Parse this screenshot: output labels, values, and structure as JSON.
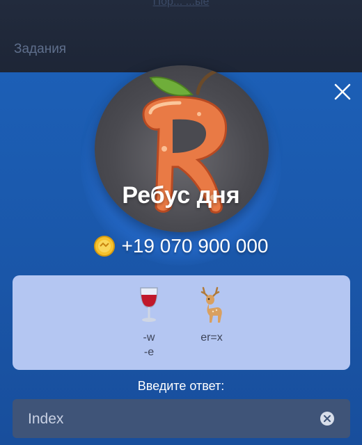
{
  "background": {
    "top_link": "Пор... ...ые",
    "tab_label": "Задания"
  },
  "modal": {
    "avatar_icon": "apple-letter-r-icon",
    "title": "Ребус дня",
    "reward": {
      "icon": "coin-icon",
      "value": "+19 070 900 000"
    },
    "puzzle": [
      {
        "icon": "wine-glass-icon",
        "hint": "-w\n-e"
      },
      {
        "icon": "deer-icon",
        "hint": "er=x"
      }
    ],
    "answer_label": "Введите ответ:",
    "answer_input": {
      "value": "Index",
      "placeholder": ""
    }
  },
  "colors": {
    "modal_bg": "#1c5fb6",
    "card_bg": "#b4c6f2",
    "input_bg": "#3f5478"
  }
}
